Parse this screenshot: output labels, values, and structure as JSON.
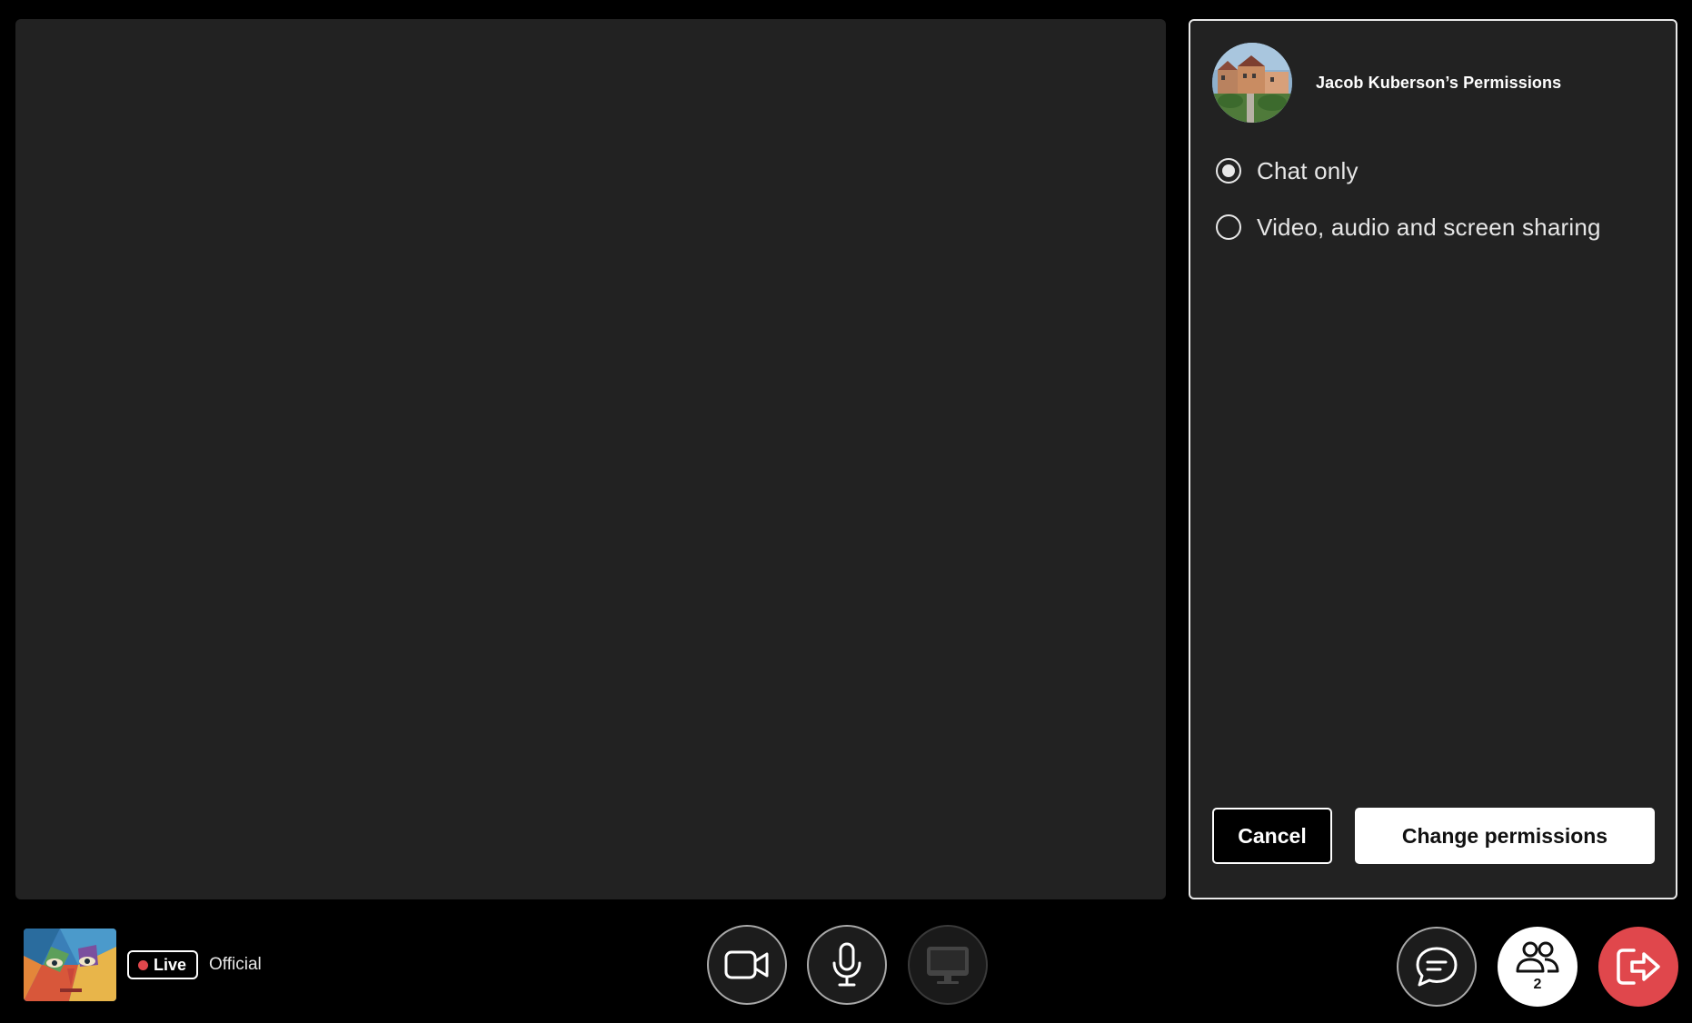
{
  "stage": {
    "video_area": "main-video"
  },
  "permissions_panel": {
    "title": "Jacob Kuberson’s Permissions",
    "options": [
      {
        "label": "Chat only",
        "selected": true
      },
      {
        "label": "Video, audio and screen sharing",
        "selected": false
      }
    ],
    "cancel_label": "Cancel",
    "confirm_label": "Change permissions"
  },
  "room": {
    "live_label": "Live",
    "name": "Official"
  },
  "controls": {
    "camera_icon": "video-camera-icon",
    "mic_icon": "microphone-icon",
    "screen_icon": "monitor-icon",
    "screen_share_disabled": true,
    "chat_icon": "chat-bubble-icon",
    "people_icon": "people-icon",
    "people_count": "2",
    "leave_icon": "leave-icon"
  },
  "colors": {
    "background": "#000000",
    "panel": "#222222",
    "live_dot": "#e0474c",
    "leave_button": "#e0474c",
    "primary_button": "#ffffff"
  }
}
